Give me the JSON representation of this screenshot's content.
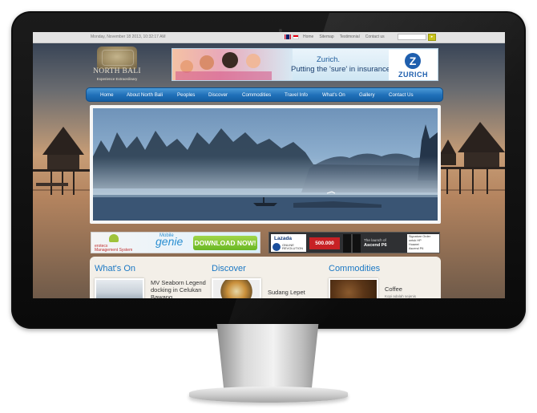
{
  "topbar": {
    "date": "Monday, November 18 2013, 10:32:17 AM",
    "links": [
      "Home",
      "Sitemap",
      "Testimonial",
      "Contact us"
    ]
  },
  "logo": {
    "title": "NORTH BALI",
    "tagline": "Experience Extraordinary"
  },
  "banner": {
    "brand": "Zurich.",
    "slogan": "Putting the 'sure' in insurance.",
    "logo_letter": "Z",
    "logo_word": "ZURICH"
  },
  "nav": {
    "items": [
      "Home",
      "About North Bali",
      "Peoples",
      "Discover",
      "Commodities",
      "Travel Info",
      "What's On",
      "Gallery",
      "Contact Us"
    ]
  },
  "ads": {
    "left": {
      "brand": "genie",
      "brand_prefix": "Mobile",
      "cta": "DOWNLOAD NOW!",
      "tagline": "erotecs\nManagement System"
    },
    "right": {
      "store": "Lazada",
      "store_sub": "ONLINE\nREVOLUTION",
      "prize": "500.000",
      "launch_line": "The launch of",
      "product": "Ascend P6",
      "box_lines": [
        "Signature Order",
        "untuk HP",
        "Huawei",
        "Ascend P6"
      ]
    }
  },
  "sections": [
    {
      "heading": "What's On",
      "item_title": "MV Seaborn Legend docking in Celukan Bawang",
      "item_sub": ""
    },
    {
      "heading": "Discover",
      "item_title": "Sudang Lepet",
      "item_sub": ""
    },
    {
      "heading": "Commodities",
      "item_title": "Coffee",
      "item_sub": "Kopi adalah sejenis"
    }
  ],
  "colors": {
    "nav_blue": "#1f6fb8",
    "heading_blue": "#1b78c4",
    "download_green": "#6ab724",
    "zurich_blue": "#1f5fae"
  }
}
